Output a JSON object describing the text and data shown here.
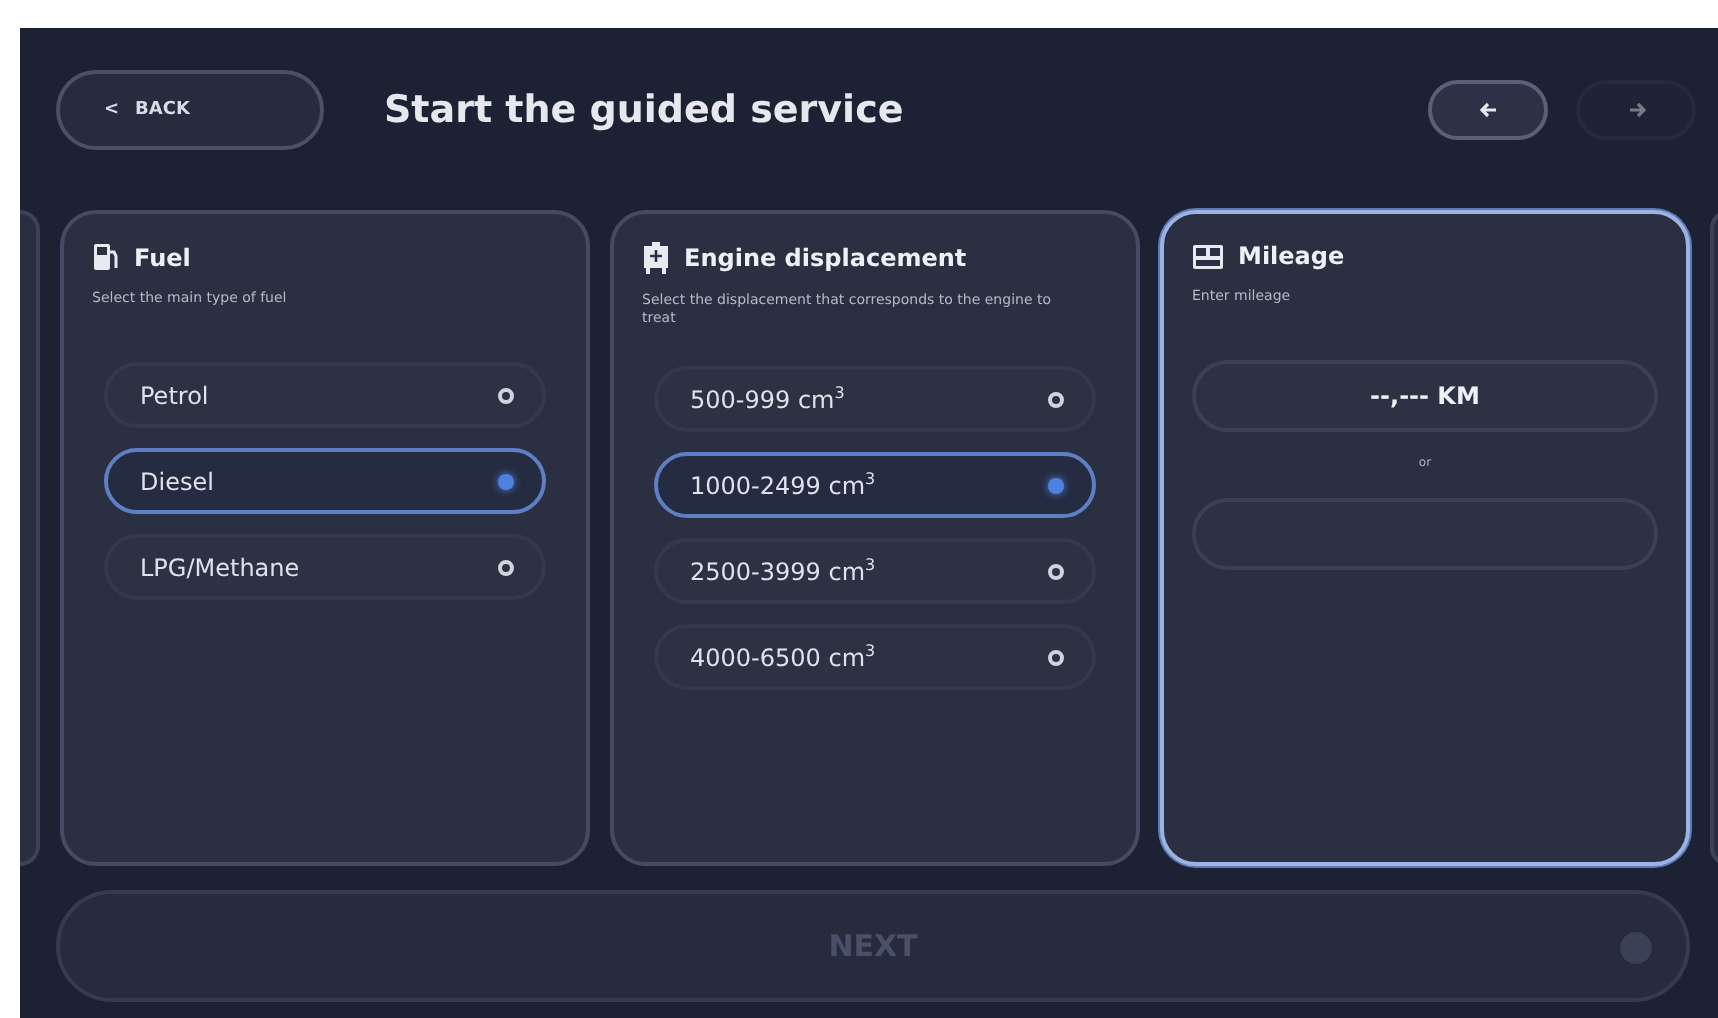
{
  "header": {
    "back_button": {
      "icon": "<",
      "label": "BACK"
    },
    "title": "Start the guided service",
    "nav": [
      {
        "disabled": false
      },
      {
        "disabled": true
      }
    ]
  },
  "cards": [
    {
      "kind": "options",
      "title": "Fuel",
      "subtitle": "Select the main type of fuel",
      "selected": false,
      "options": [
        {
          "label": "Petrol",
          "selected": false
        },
        {
          "label": "Diesel",
          "selected": true
        },
        {
          "label": "LPG/Methane",
          "selected": false
        }
      ]
    },
    {
      "kind": "options",
      "title": "Engine displacement",
      "subtitle": "Select the displacement that corresponds to the engine to treat",
      "selected": false,
      "options": [
        {
          "label": "500-999 cm$^{3}$",
          "selected": false
        },
        {
          "label": "1000-2499 cm$^{3}$",
          "selected": true
        },
        {
          "label": "2500-3999 cm$^{3}$",
          "selected": false
        },
        {
          "label": "4000-6500 cm$^{3}$",
          "selected": false
        }
      ]
    },
    {
      "kind": "mileage",
      "title": "Mileage",
      "subtitle": "Enter mileage",
      "selected": true,
      "value": "--,--- KM",
      "separator": "or"
    }
  ],
  "next_button": {
    "label": "NEXT",
    "disabled": true
  }
}
